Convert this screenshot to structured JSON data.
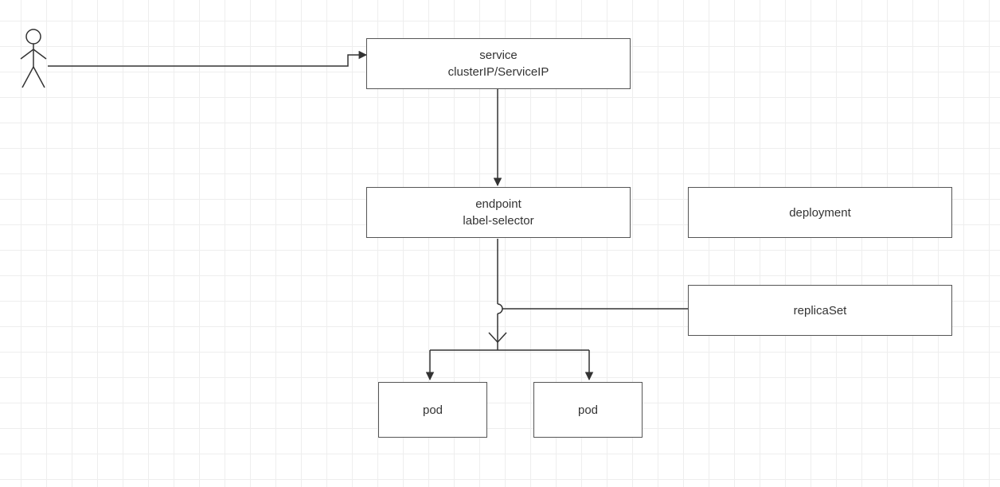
{
  "nodes": {
    "service": {
      "line1": "service",
      "line2": "clusterIP/ServiceIP"
    },
    "endpoint": {
      "line1": "endpoint",
      "line2": "label-selector"
    },
    "deployment": {
      "label": "deployment"
    },
    "replicaset": {
      "label": "replicaSet"
    },
    "pod1": {
      "label": "pod"
    },
    "pod2": {
      "label": "pod"
    }
  },
  "actor": {
    "name": "user"
  },
  "edges": [
    {
      "from": "user",
      "to": "service"
    },
    {
      "from": "service",
      "to": "endpoint"
    },
    {
      "from": "endpoint",
      "to": "pod-split"
    },
    {
      "from": "replicaset",
      "to": "pod-split"
    }
  ]
}
